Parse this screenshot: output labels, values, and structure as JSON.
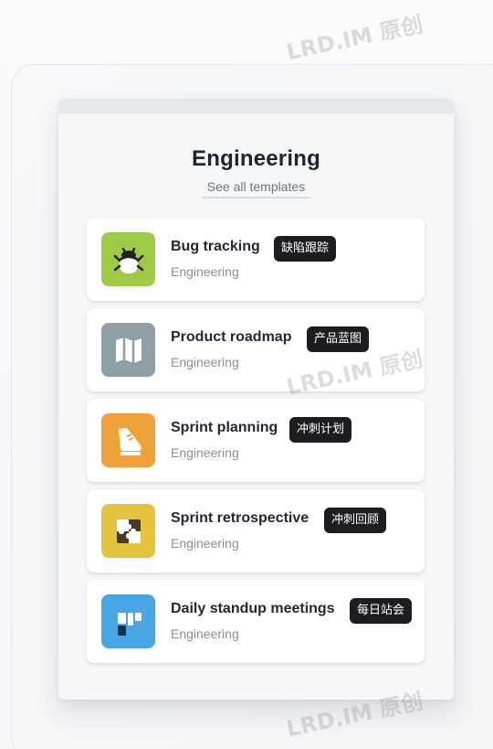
{
  "panel": {
    "title": "Engineering",
    "see_all_label": "See all templates"
  },
  "templates": [
    {
      "name": "Bug tracking",
      "category": "Engineering",
      "badge": "缺陷跟踪",
      "icon": "bug-icon",
      "tile_color": "#9fca45"
    },
    {
      "name": "Product roadmap",
      "category": "Engineering",
      "badge": "产品蓝图",
      "icon": "map-icon",
      "tile_color": "#8f9fa5"
    },
    {
      "name": "Sprint planning",
      "category": "Engineering",
      "badge": "冲刺计划",
      "icon": "sneaker-icon",
      "tile_color": "#f0a13a"
    },
    {
      "name": "Sprint retrospective",
      "category": "Engineering",
      "badge": "冲刺回顾",
      "icon": "puzzle-icon",
      "tile_color": "#e6c33f"
    },
    {
      "name": "Daily standup meetings",
      "category": "Engineering",
      "badge": "每日站会",
      "icon": "board-icon",
      "tile_color": "#49a5e6"
    }
  ],
  "watermark": "LRD.IM 原创"
}
